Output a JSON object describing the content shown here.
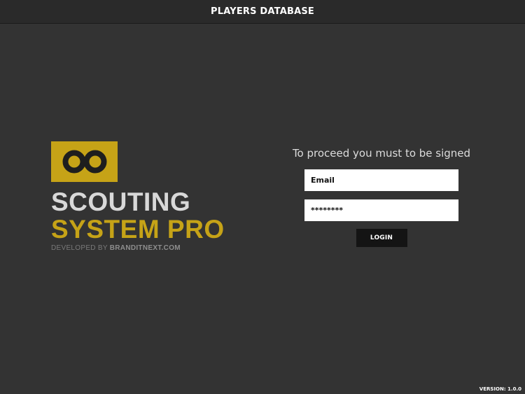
{
  "header": {
    "title": "PLAYERS DATABASE"
  },
  "brand": {
    "logo_icon": "infinity-icon",
    "line1": "SCOUTING",
    "line2": "SYSTEM PRO",
    "developed_prefix": "DEVELOPED BY ",
    "developed_site": "BRANDITNEXT.COM"
  },
  "login": {
    "prompt": "To proceed you must to be signed",
    "email_placeholder": "Email",
    "password_value": "********",
    "button_label": "LOGIN"
  },
  "footer": {
    "version": "VERSION: 1.0.0"
  },
  "colors": {
    "background": "#333333",
    "topbar": "#2a2a2a",
    "accent": "#c6a317",
    "button": "#141414"
  }
}
